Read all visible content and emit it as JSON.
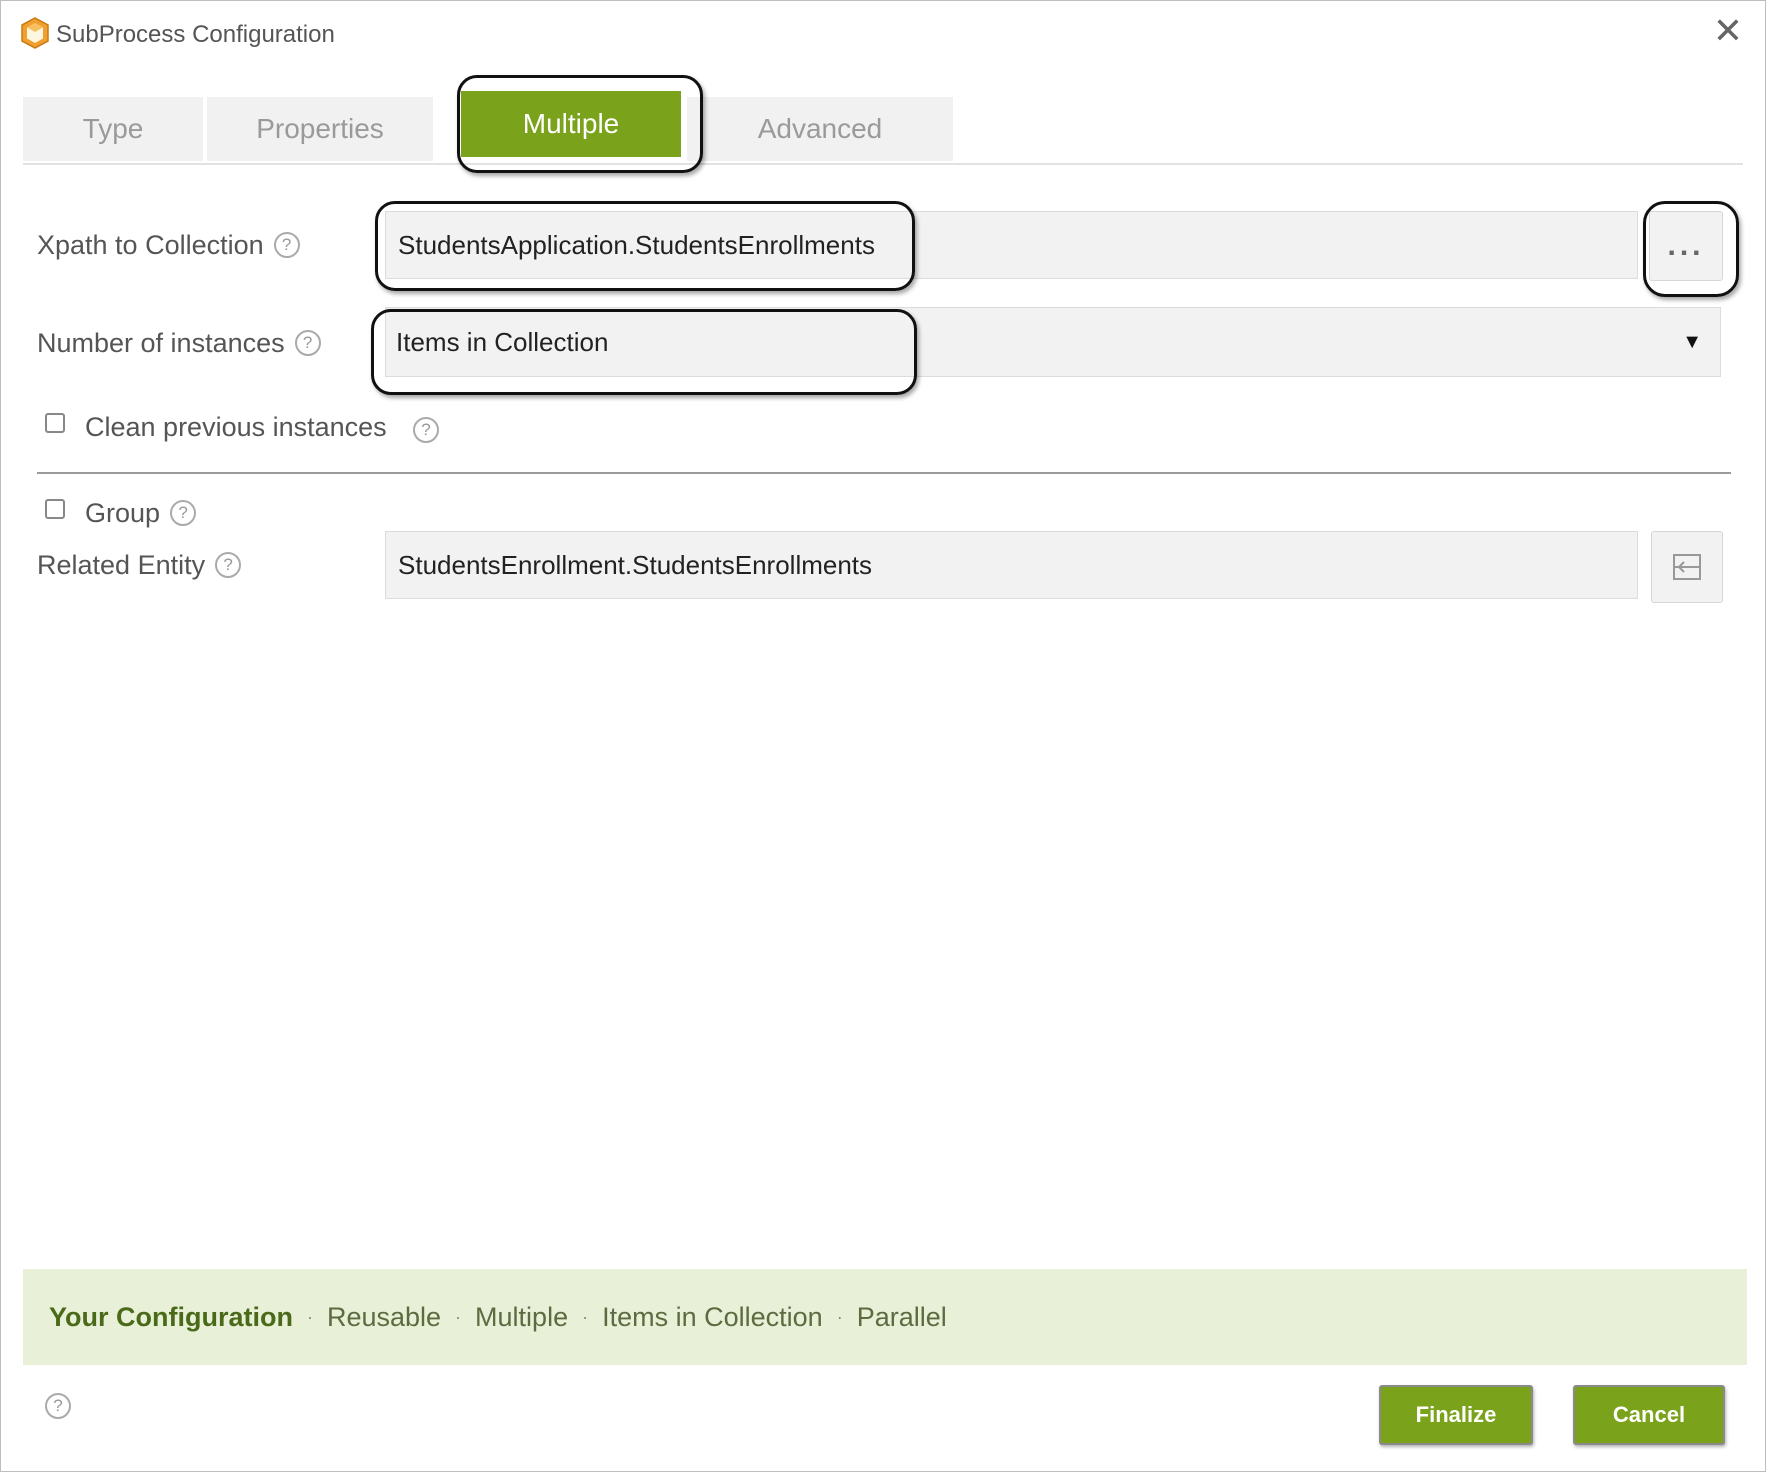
{
  "window": {
    "title": "SubProcess Configuration",
    "close_icon": "close-icon",
    "app_icon": "package-icon",
    "accent_color": "#7aa21a"
  },
  "tabs": [
    {
      "label": "Type"
    },
    {
      "label": "Properties"
    },
    {
      "label": "Multiple",
      "active": true
    },
    {
      "label": "Advanced"
    }
  ],
  "form": {
    "xpath_label": "Xpath to Collection",
    "xpath_value": "StudentsApplication.StudentsEnrollments",
    "browse_label": "...",
    "instances_label": "Number of instances",
    "instances_value": "Items in Collection",
    "clean_label": "Clean previous instances",
    "group_label": "Group",
    "related_label": "Related Entity",
    "related_value": "StudentsEnrollment.StudentsEnrollments",
    "help_glyph": "?"
  },
  "summary": {
    "heading": "Your Configuration",
    "items": [
      "Reusable",
      "Multiple",
      "Items in Collection",
      "Parallel"
    ],
    "separator": "·"
  },
  "footer": {
    "finalize_label": "Finalize",
    "cancel_label": "Cancel"
  }
}
